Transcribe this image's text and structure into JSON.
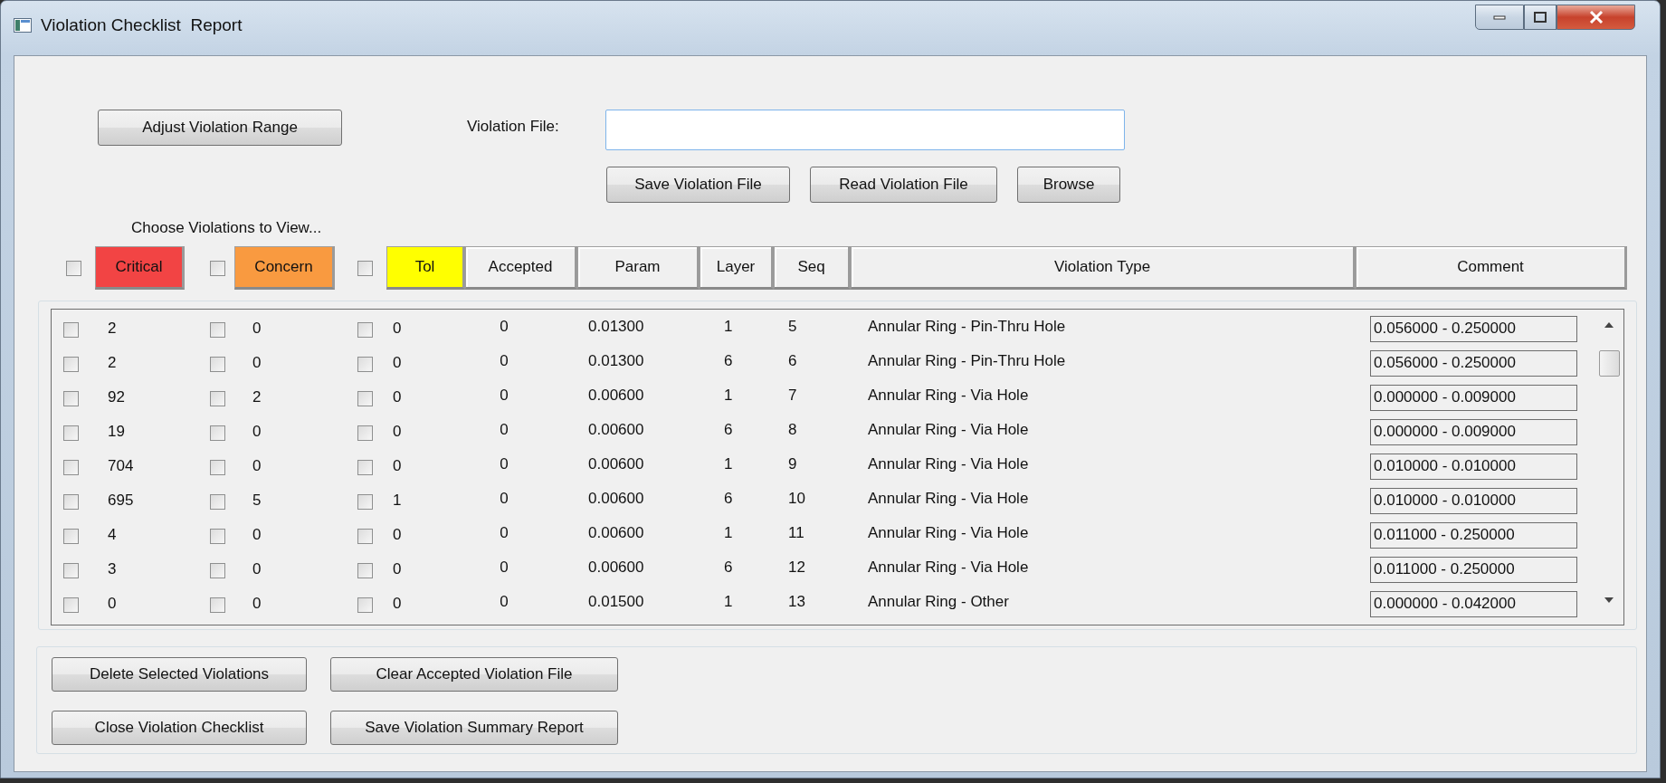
{
  "window": {
    "title": "Violation Checklist  Report"
  },
  "adjust_button": "Adjust Violation Range",
  "violation_file": {
    "label": "Violation File:",
    "focused": true
  },
  "file_buttons": [
    "Save Violation File",
    "Read Violation File",
    "Browse"
  ],
  "filter_caption": "Choose Violations to View...",
  "columns": [
    {
      "kind": "filter",
      "label": "Critical",
      "checked": false,
      "color": "#f24444"
    },
    {
      "kind": "filter",
      "label": "Concern",
      "checked": false,
      "color": "#f99a40"
    },
    {
      "kind": "filter",
      "label": "Tol",
      "checked": false,
      "color": "#ffff00"
    },
    {
      "kind": "header",
      "label": "Accepted"
    },
    {
      "kind": "header",
      "label": "Param"
    },
    {
      "kind": "header",
      "label": "Layer"
    },
    {
      "kind": "header",
      "label": "Seq"
    },
    {
      "kind": "header",
      "label": "Violation Type"
    },
    {
      "kind": "header",
      "label": "Comment"
    }
  ],
  "rows": [
    {
      "critical": "2",
      "critical_checked": false,
      "concern": "0",
      "concern_checked": false,
      "tol": "0",
      "tol_checked": false,
      "accepted": "0",
      "param": "0.01300",
      "layer": "1",
      "seq": "5",
      "violation_type": "Annular Ring - Pin-Thru Hole",
      "comment": "0.056000 - 0.250000"
    },
    {
      "critical": "2",
      "critical_checked": false,
      "concern": "0",
      "concern_checked": false,
      "tol": "0",
      "tol_checked": false,
      "accepted": "0",
      "param": "0.01300",
      "layer": "6",
      "seq": "6",
      "violation_type": "Annular Ring - Pin-Thru Hole",
      "comment": "0.056000 - 0.250000"
    },
    {
      "critical": "92",
      "critical_checked": false,
      "concern": "2",
      "concern_checked": false,
      "tol": "0",
      "tol_checked": false,
      "accepted": "0",
      "param": "0.00600",
      "layer": "1",
      "seq": "7",
      "violation_type": "Annular Ring - Via Hole",
      "comment": "0.000000 - 0.009000"
    },
    {
      "critical": "19",
      "critical_checked": false,
      "concern": "0",
      "concern_checked": false,
      "tol": "0",
      "tol_checked": false,
      "accepted": "0",
      "param": "0.00600",
      "layer": "6",
      "seq": "8",
      "violation_type": "Annular Ring - Via Hole",
      "comment": "0.000000 - 0.009000"
    },
    {
      "critical": "704",
      "critical_checked": false,
      "concern": "0",
      "concern_checked": false,
      "tol": "0",
      "tol_checked": false,
      "accepted": "0",
      "param": "0.00600",
      "layer": "1",
      "seq": "9",
      "violation_type": "Annular Ring - Via Hole",
      "comment": "0.010000 - 0.010000"
    },
    {
      "critical": "695",
      "critical_checked": false,
      "concern": "5",
      "concern_checked": false,
      "tol": "1",
      "tol_checked": false,
      "accepted": "0",
      "param": "0.00600",
      "layer": "6",
      "seq": "10",
      "violation_type": "Annular Ring - Via Hole",
      "comment": "0.010000 - 0.010000"
    },
    {
      "critical": "4",
      "critical_checked": false,
      "concern": "0",
      "concern_checked": false,
      "tol": "0",
      "tol_checked": false,
      "accepted": "0",
      "param": "0.00600",
      "layer": "1",
      "seq": "11",
      "violation_type": "Annular Ring - Via Hole",
      "comment": "0.011000 - 0.250000"
    },
    {
      "critical": "3",
      "critical_checked": false,
      "concern": "0",
      "concern_checked": false,
      "tol": "0",
      "tol_checked": false,
      "accepted": "0",
      "param": "0.00600",
      "layer": "6",
      "seq": "12",
      "violation_type": "Annular Ring - Via Hole",
      "comment": "0.011000 - 0.250000"
    },
    {
      "critical": "0",
      "critical_checked": false,
      "concern": "0",
      "concern_checked": false,
      "tol": "0",
      "tol_checked": false,
      "accepted": "0",
      "param": "0.01500",
      "layer": "1",
      "seq": "13",
      "violation_type": "Annular Ring - Other",
      "comment": "0.000000 - 0.042000"
    }
  ],
  "action_buttons": [
    "Delete Selected Violations",
    "Clear Accepted Violation File",
    "Close Violation Checklist",
    "Save Violation Summary Report"
  ]
}
